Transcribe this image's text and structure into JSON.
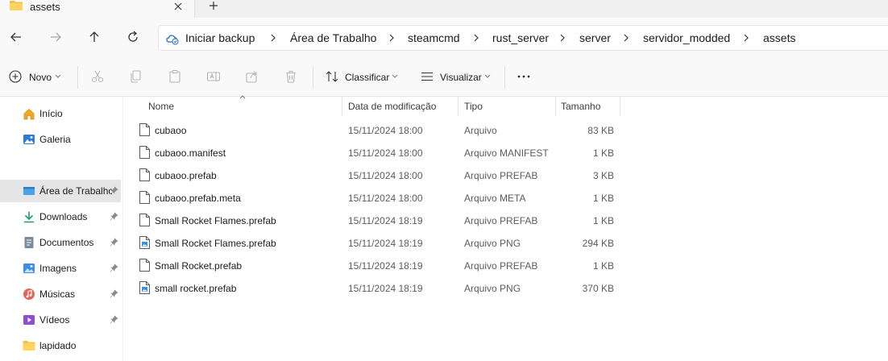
{
  "tab": {
    "title": "assets"
  },
  "address": {
    "crumbs": [
      "Iniciar backup",
      "Área de Trabalho",
      "steamcmd",
      "rust_server",
      "server",
      "servidor_modded",
      "assets"
    ]
  },
  "commands": {
    "new": "Novo",
    "sort": "Classificar",
    "view": "Visualizar"
  },
  "sidebar": {
    "items": [
      {
        "label": "Início",
        "icon": "home-icon"
      },
      {
        "label": "Galeria",
        "icon": "gallery-icon"
      },
      {
        "label": "Área de Trabalho",
        "icon": "desktop-icon",
        "pinned": true,
        "active": true
      },
      {
        "label": "Downloads",
        "icon": "download-icon",
        "pinned": true
      },
      {
        "label": "Documentos",
        "icon": "documents-icon",
        "pinned": true
      },
      {
        "label": "Imagens",
        "icon": "images-icon",
        "pinned": true
      },
      {
        "label": "Músicas",
        "icon": "music-icon",
        "pinned": true
      },
      {
        "label": "Vídeos",
        "icon": "videos-icon",
        "pinned": true
      },
      {
        "label": "lapidado",
        "icon": "folder-icon"
      }
    ]
  },
  "columns": {
    "name": "Nome",
    "date": "Data de modificação",
    "type": "Tipo",
    "size": "Tamanho"
  },
  "files": [
    {
      "name": "cubaoo",
      "date": "15/11/2024 18:00",
      "type": "Arquivo",
      "size": "83 KB",
      "icon": "file-icon"
    },
    {
      "name": "cubaoo.manifest",
      "date": "15/11/2024 18:00",
      "type": "Arquivo MANIFEST",
      "size": "1 KB",
      "icon": "file-icon"
    },
    {
      "name": "cubaoo.prefab",
      "date": "15/11/2024 18:00",
      "type": "Arquivo PREFAB",
      "size": "3 KB",
      "icon": "file-icon"
    },
    {
      "name": "cubaoo.prefab.meta",
      "date": "15/11/2024 18:00",
      "type": "Arquivo META",
      "size": "1 KB",
      "icon": "file-icon"
    },
    {
      "name": "Small Rocket Flames.prefab",
      "date": "15/11/2024 18:19",
      "type": "Arquivo PREFAB",
      "size": "1 KB",
      "icon": "file-icon"
    },
    {
      "name": "Small Rocket Flames.prefab",
      "date": "15/11/2024 18:19",
      "type": "Arquivo PNG",
      "size": "294 KB",
      "icon": "image-file-icon"
    },
    {
      "name": "Small Rocket.prefab",
      "date": "15/11/2024 18:19",
      "type": "Arquivo PREFAB",
      "size": "1 KB",
      "icon": "file-icon"
    },
    {
      "name": "small rocket.prefab",
      "date": "15/11/2024 18:19",
      "type": "Arquivo PNG",
      "size": "370 KB",
      "icon": "image-file-icon"
    }
  ]
}
